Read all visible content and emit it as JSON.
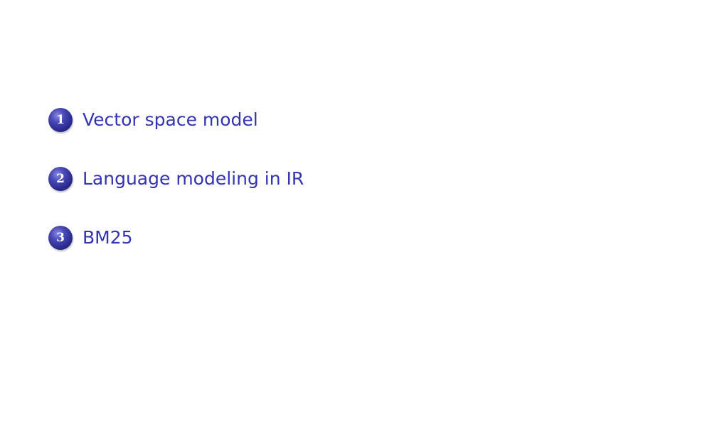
{
  "toc": {
    "items": [
      {
        "number": "1",
        "label": "Vector space model"
      },
      {
        "number": "2",
        "label": "Language modeling in IR"
      },
      {
        "number": "3",
        "label": "BM25"
      }
    ]
  },
  "colors": {
    "link_text": "#3333b3",
    "ball": "#2b2b90",
    "background": "#ffffff"
  }
}
